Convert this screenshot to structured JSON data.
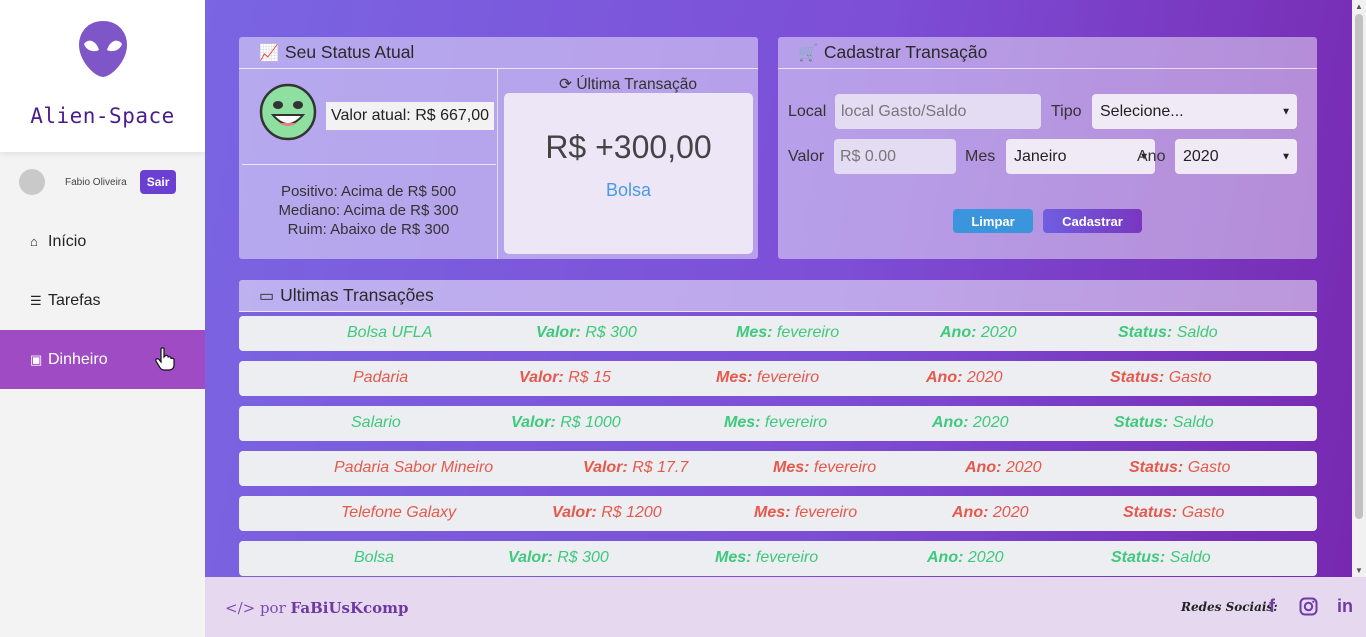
{
  "sidebar": {
    "brand": "Alien-Space",
    "user_name": "Fabio Oliveira",
    "logout_label": "Sair",
    "nav": [
      {
        "label": "Início",
        "icon": "home-icon"
      },
      {
        "label": "Tarefas",
        "icon": "tasks-icon"
      },
      {
        "label": "Dinheiro",
        "icon": "money-icon",
        "active": true
      }
    ]
  },
  "status": {
    "title": "Seu Status Atual",
    "current_value": "Valor atual: R$ 667,00",
    "levels": [
      "Positivo: Acima de R$ 500",
      "Mediano: Acima de R$ 300",
      "Ruim: Abaixo de R$ 300"
    ],
    "last_tx_label": "Última Transação",
    "last_tx_value": "R$ +300,00",
    "last_tx_category": "Bolsa"
  },
  "register": {
    "title": "Cadastrar Transação",
    "local_label": "Local",
    "local_placeholder": "local Gasto/Saldo",
    "tipo_label": "Tipo",
    "tipo_value": "Selecione...",
    "valor_label": "Valor",
    "valor_placeholder": "R$ 0.00",
    "mes_label": "Mes",
    "mes_value": "Janeiro",
    "ano_label": "Ano",
    "ano_value": "2020",
    "clear_label": "Limpar",
    "submit_label": "Cadastrar"
  },
  "transactions": {
    "title": "Ultimas Transações",
    "k_valor": "Valor:",
    "k_mes": "Mes:",
    "k_ano": "Ano:",
    "k_status": "Status:",
    "rows": [
      {
        "local": "Bolsa UFLA",
        "valor": "R$ 300",
        "mes": "fevereiro",
        "ano": "2020",
        "status": "Saldo"
      },
      {
        "local": "Padaria",
        "valor": "R$ 15",
        "mes": "fevereiro",
        "ano": "2020",
        "status": "Gasto"
      },
      {
        "local": "Salario",
        "valor": "R$ 1000",
        "mes": "fevereiro",
        "ano": "2020",
        "status": "Saldo"
      },
      {
        "local": "Padaria Sabor Mineiro",
        "valor": "R$ 17.7",
        "mes": "fevereiro",
        "ano": "2020",
        "status": "Gasto"
      },
      {
        "local": "Telefone Galaxy",
        "valor": "R$ 1200",
        "mes": "fevereiro",
        "ano": "2020",
        "status": "Gasto"
      },
      {
        "local": "Bolsa",
        "valor": "R$ 300",
        "mes": "fevereiro",
        "ano": "2020",
        "status": "Saldo"
      }
    ]
  },
  "footer": {
    "credit_prefix": "</> por",
    "credit_name": "FaBiUsKcomp",
    "social_label": "Redes Sociais:",
    "social_icons": [
      "facebook-icon",
      "instagram-icon",
      "linkedin-icon"
    ]
  },
  "colors": {
    "accent": "#6a3fd2",
    "sidebar_active": "#9f4cc4",
    "saldo": "#3ec97c",
    "gasto": "#e5594c"
  }
}
